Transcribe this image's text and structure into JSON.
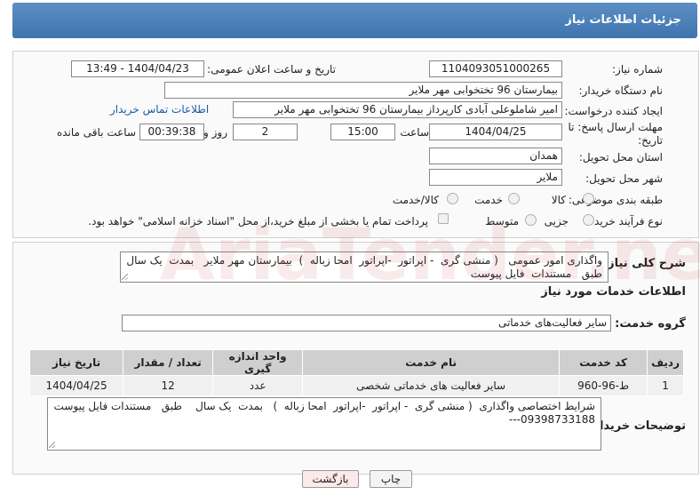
{
  "header": {
    "title": "جزئیات اطلاعات نیاز"
  },
  "form": {
    "need_number_label": "شماره نیاز:",
    "need_number": "1104093051000265",
    "announce_label": "تاریخ و ساعت اعلان عمومی:",
    "announce_value": "1404/04/23 - 13:49",
    "buyer_org_label": "نام دستگاه خریدار:",
    "buyer_org": "بیمارستان 96 تختخوابی مهر ملایر",
    "creator_label": "ایجاد کننده درخواست:",
    "creator": "امیر شاملوعلی آبادی کارپرداز بیمارستان 96 تختخوابی مهر ملایر",
    "contact_link": "اطلاعات تماس خریدار",
    "deadline_label_1": "مهلت ارسال پاسخ: تا",
    "deadline_label_2": "تاریخ:",
    "deadline_date": "1404/04/25",
    "time_label": "ساعت",
    "deadline_time": "15:00",
    "days_value": "2",
    "days_label": "روز و",
    "remaining_time": "00:39:38",
    "remaining_label": "ساعت باقی مانده",
    "province_label": "استان محل تحویل:",
    "province": "همدان",
    "city_label": "شهر محل تحویل:",
    "city": "ملایر",
    "category_label": "طبقه بندی موضوعی:",
    "category_options": [
      "کالا",
      "خدمت",
      "کالا/خدمت"
    ],
    "process_label": "نوع فرآیند خرید :",
    "process_options": [
      "جزیی",
      "متوسط"
    ],
    "payment_note": "پرداخت تمام یا بخشی از مبلغ خرید،از محل \"اسناد خزانه اسلامی\" خواهد بود."
  },
  "summary": {
    "label": "شرح کلی نیاز:",
    "text": "واگذاری امور عمومی   ( منشی گری  - اپراتور  -اپراتور  امحا زباله  )  بیمارستان مهر ملایر   بمدت  یک سال   طبق   مستندات  فایل پیوست"
  },
  "services": {
    "section_title": "اطلاعات خدمات مورد نیاز",
    "group_label": "گروه خدمت:",
    "group_value": "سایر فعالیت‌های خدماتی",
    "columns": [
      "ردیف",
      "کد خدمت",
      "نام خدمت",
      "واحد اندازه گیری",
      "تعداد / مقدار",
      "تاریخ نیاز"
    ],
    "rows": [
      [
        "1",
        "ط-96-960",
        "سایر فعالیت های خدماتی شخصی",
        "عدد",
        "12",
        "1404/04/25"
      ]
    ]
  },
  "buyer_notes": {
    "label": "توضیحات خریدار:",
    "text": "شرایط اختصاصی واگذاری  ( منشی گری  - اپراتور  -اپراتور  امحا زباله  )   بمدت  یک سال    طبق   مستندات فایل پیوست\n09398733188---"
  },
  "buttons": {
    "print": "چاپ",
    "back": "بازگشت"
  },
  "watermark_text": "AriaTender.neT",
  "colors": {
    "header": "#4a7fbb",
    "link": "#1a5aa8",
    "back_button": "#fde9ea"
  }
}
